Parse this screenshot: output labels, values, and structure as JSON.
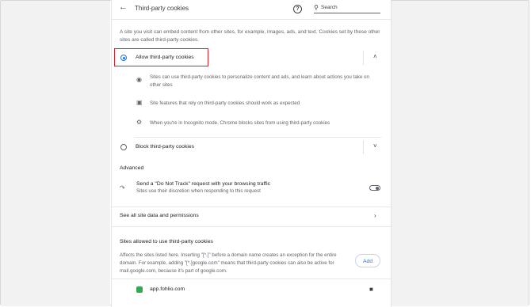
{
  "header": {
    "title": "Third-party cookies",
    "search_placeholder": "Search"
  },
  "intro": "A site you visit can embed content from other sites, for example, images, ads, and text. Cookies set by these other sites are called third-party cookies.",
  "allow": {
    "label": "Allow third-party cookies",
    "selected": true,
    "details": [
      {
        "icon": "cookie-icon",
        "text": "Sites can use third-party cookies to personalize content and ads, and learn about actions you take on other sites"
      },
      {
        "icon": "page-icon",
        "text": "Site features that rely on third-party cookies should work as expected"
      },
      {
        "icon": "incognito-icon",
        "text": "When you're in Incognito mode, Chrome blocks sites from using third-party cookies"
      }
    ]
  },
  "block": {
    "label": "Block third-party cookies"
  },
  "advanced": {
    "heading": "Advanced",
    "dnt_title": "Send a \"Do Not Track\" request with your browsing traffic",
    "dnt_sub": "Sites use their discretion when responding to this request"
  },
  "see_all": "See all site data and permissions",
  "allowed_sites": {
    "heading": "Sites allowed to use third-party cookies",
    "description": "Affects the sites listed here. Inserting \"[*.]\" before a domain name creates an exception for the entire domain. For example, adding \"[*.]google.com\" means that third-party cookies can also be active for mail.google.com, because it's part of google.com.",
    "add_label": "Add",
    "sites": [
      "app.fohlio.com"
    ]
  },
  "colors": {
    "accent": "#1a73e8",
    "highlight": "#e11d2a"
  }
}
